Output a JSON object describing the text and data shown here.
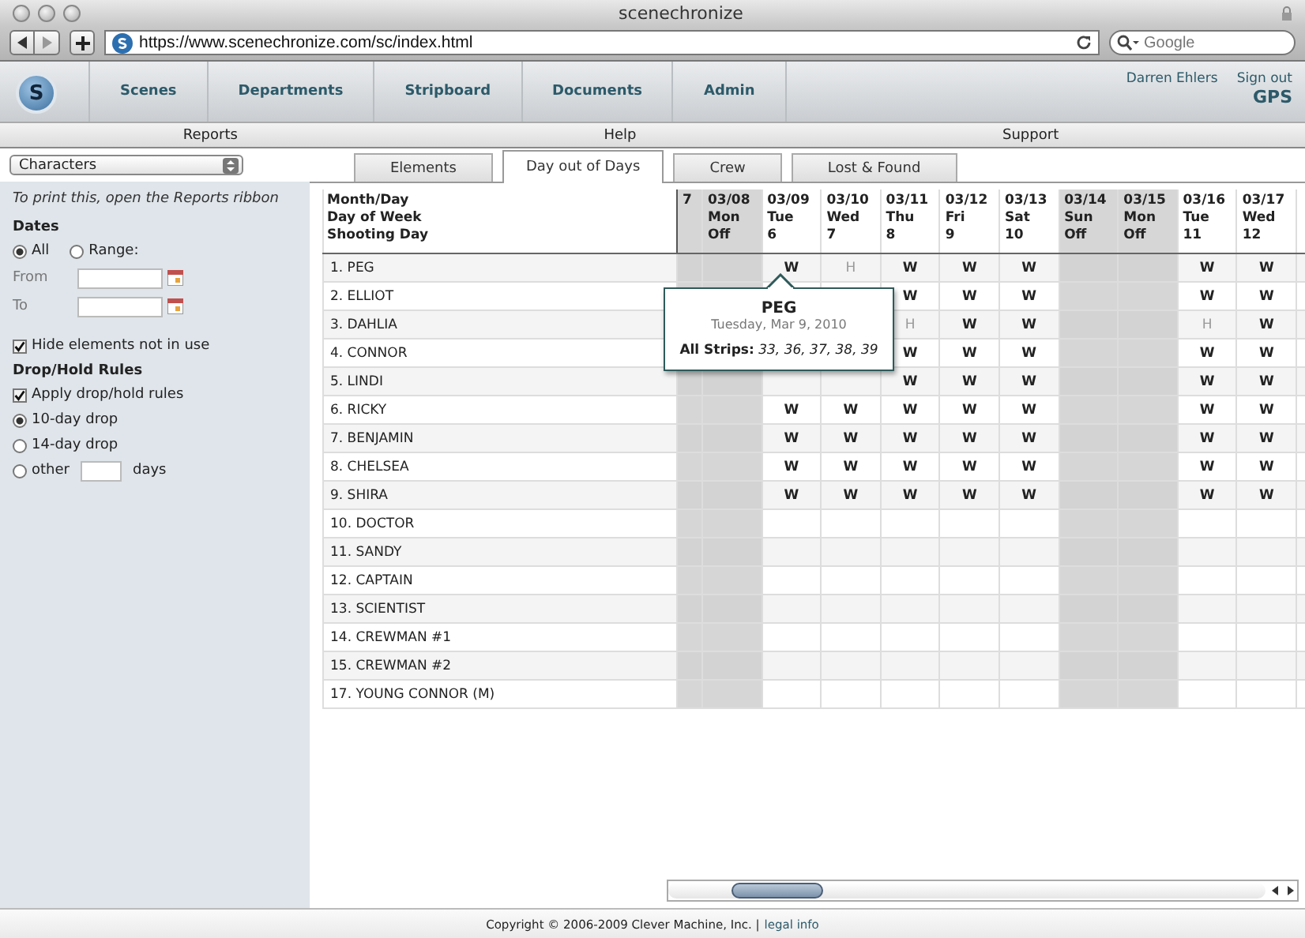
{
  "window": {
    "title": "scenechronize"
  },
  "browser": {
    "url": "https://www.scenechronize.com/sc/index.html",
    "search_placeholder": "Google"
  },
  "nav": {
    "logo": "S",
    "items": [
      "Scenes",
      "Departments",
      "Stripboard",
      "Documents",
      "Admin"
    ],
    "user": "Darren Ehlers",
    "sign_out": "Sign out",
    "project": "GPS"
  },
  "ribbon": [
    "Reports",
    "Help",
    "Support"
  ],
  "element_type": "Characters",
  "tabs": [
    {
      "label": "Elements",
      "selected": false
    },
    {
      "label": "Day out of Days",
      "selected": true
    },
    {
      "label": "Crew",
      "selected": false
    },
    {
      "label": "Lost & Found",
      "selected": false
    }
  ],
  "sidebar": {
    "note": "To print this, open the Reports ribbon",
    "dates_heading": "Dates",
    "date_options": [
      {
        "label": "All",
        "selected": true
      },
      {
        "label": "Range:",
        "selected": false
      }
    ],
    "from_label": "From",
    "to_label": "To",
    "hide_unused": {
      "label": "Hide elements not in use",
      "checked": true
    },
    "rules_heading": "Drop/Hold Rules",
    "apply_rules": {
      "label": "Apply drop/hold rules",
      "checked": true
    },
    "drop_options": [
      {
        "label": "10-day drop",
        "selected": true
      },
      {
        "label": "14-day drop",
        "selected": false
      },
      {
        "label": "other",
        "selected": false
      }
    ],
    "other_suffix": "days"
  },
  "table": {
    "header_labels": [
      "Month/Day",
      "Day of Week",
      "Shooting Day"
    ],
    "columns": [
      {
        "lines": [
          "7"
        ],
        "off": true
      },
      {
        "lines": [
          "03/08",
          "Mon",
          "Off"
        ],
        "off": true
      },
      {
        "lines": [
          "03/09",
          "Tue",
          "6"
        ],
        "off": false
      },
      {
        "lines": [
          "03/10",
          "Wed",
          "7"
        ],
        "off": false
      },
      {
        "lines": [
          "03/11",
          "Thu",
          "8"
        ],
        "off": false
      },
      {
        "lines": [
          "03/12",
          "Fri",
          "9"
        ],
        "off": false
      },
      {
        "lines": [
          "03/13",
          "Sat",
          "10"
        ],
        "off": false
      },
      {
        "lines": [
          "03/14",
          "Sun",
          "Off"
        ],
        "off": true
      },
      {
        "lines": [
          "03/15",
          "Mon",
          "Off"
        ],
        "off": true
      },
      {
        "lines": [
          "03/16",
          "Tue",
          "11"
        ],
        "off": false
      },
      {
        "lines": [
          "03/17",
          "Wed",
          "12"
        ],
        "off": false
      }
    ],
    "rows": [
      {
        "name": "1. PEG",
        "cells": [
          null,
          null,
          {
            "text": "W",
            "kind": "work"
          },
          {
            "text": "H",
            "kind": "hold"
          },
          {
            "text": "W",
            "kind": "work"
          },
          {
            "text": "W",
            "kind": "work"
          },
          {
            "text": "W",
            "kind": "work"
          },
          null,
          null,
          {
            "text": "W",
            "kind": "work"
          },
          {
            "text": "W",
            "kind": "work"
          }
        ]
      },
      {
        "name": "2. ELLIOT",
        "cells": [
          null,
          null,
          null,
          null,
          {
            "text": "W",
            "kind": "work"
          },
          {
            "text": "W",
            "kind": "work"
          },
          {
            "text": "W",
            "kind": "work"
          },
          null,
          null,
          {
            "text": "W",
            "kind": "work"
          },
          {
            "text": "W",
            "kind": "work"
          }
        ]
      },
      {
        "name": "3. DAHLIA",
        "cells": [
          null,
          null,
          null,
          null,
          {
            "text": "H",
            "kind": "hold"
          },
          {
            "text": "W",
            "kind": "work"
          },
          {
            "text": "W",
            "kind": "work"
          },
          null,
          null,
          {
            "text": "H",
            "kind": "hold"
          },
          {
            "text": "W",
            "kind": "work"
          }
        ]
      },
      {
        "name": "4. CONNOR",
        "cells": [
          null,
          null,
          null,
          null,
          {
            "text": "W",
            "kind": "work"
          },
          {
            "text": "W",
            "kind": "work"
          },
          {
            "text": "W",
            "kind": "work"
          },
          null,
          null,
          {
            "text": "W",
            "kind": "work"
          },
          {
            "text": "W",
            "kind": "work"
          }
        ]
      },
      {
        "name": "5. LINDI",
        "cells": [
          null,
          null,
          null,
          null,
          {
            "text": "W",
            "kind": "work"
          },
          {
            "text": "W",
            "kind": "work"
          },
          {
            "text": "W",
            "kind": "work"
          },
          null,
          null,
          {
            "text": "W",
            "kind": "work"
          },
          {
            "text": "W",
            "kind": "work"
          }
        ]
      },
      {
        "name": "6. RICKY",
        "cells": [
          null,
          null,
          {
            "text": "W",
            "kind": "work"
          },
          {
            "text": "W",
            "kind": "work"
          },
          {
            "text": "W",
            "kind": "work"
          },
          {
            "text": "W",
            "kind": "work"
          },
          {
            "text": "W",
            "kind": "work"
          },
          null,
          null,
          {
            "text": "W",
            "kind": "work"
          },
          {
            "text": "W",
            "kind": "work"
          }
        ]
      },
      {
        "name": "7. BENJAMIN",
        "cells": [
          null,
          null,
          {
            "text": "W",
            "kind": "work"
          },
          {
            "text": "W",
            "kind": "work"
          },
          {
            "text": "W",
            "kind": "work"
          },
          {
            "text": "W",
            "kind": "work"
          },
          {
            "text": "W",
            "kind": "work"
          },
          null,
          null,
          {
            "text": "W",
            "kind": "work"
          },
          {
            "text": "W",
            "kind": "work"
          }
        ]
      },
      {
        "name": "8. CHELSEA",
        "cells": [
          null,
          null,
          {
            "text": "W",
            "kind": "work"
          },
          {
            "text": "W",
            "kind": "work"
          },
          {
            "text": "W",
            "kind": "work"
          },
          {
            "text": "W",
            "kind": "work"
          },
          {
            "text": "W",
            "kind": "work"
          },
          null,
          null,
          {
            "text": "W",
            "kind": "work"
          },
          {
            "text": "W",
            "kind": "work"
          }
        ]
      },
      {
        "name": "9. SHIRA",
        "cells": [
          null,
          null,
          {
            "text": "W",
            "kind": "work"
          },
          {
            "text": "W",
            "kind": "work"
          },
          {
            "text": "W",
            "kind": "work"
          },
          {
            "text": "W",
            "kind": "work"
          },
          {
            "text": "W",
            "kind": "work"
          },
          null,
          null,
          {
            "text": "W",
            "kind": "work"
          },
          {
            "text": "W",
            "kind": "work"
          }
        ]
      },
      {
        "name": "10. DOCTOR",
        "cells": []
      },
      {
        "name": "11. SANDY",
        "cells": []
      },
      {
        "name": "12. CAPTAIN",
        "cells": []
      },
      {
        "name": "13. SCIENTIST",
        "cells": []
      },
      {
        "name": "14. CREWMAN #1",
        "cells": []
      },
      {
        "name": "15. CREWMAN #2",
        "cells": []
      },
      {
        "name": "17. YOUNG CONNOR (M)",
        "cells": []
      }
    ]
  },
  "tooltip": {
    "title": "PEG",
    "date": "Tuesday, Mar 9, 2010",
    "strips": "**All Strips:** *33, 36, 37, 38, 39*"
  },
  "footer": {
    "copyright": "Copyright © 2006-2009 Clever Machine, Inc. |",
    "link": "legal info"
  }
}
